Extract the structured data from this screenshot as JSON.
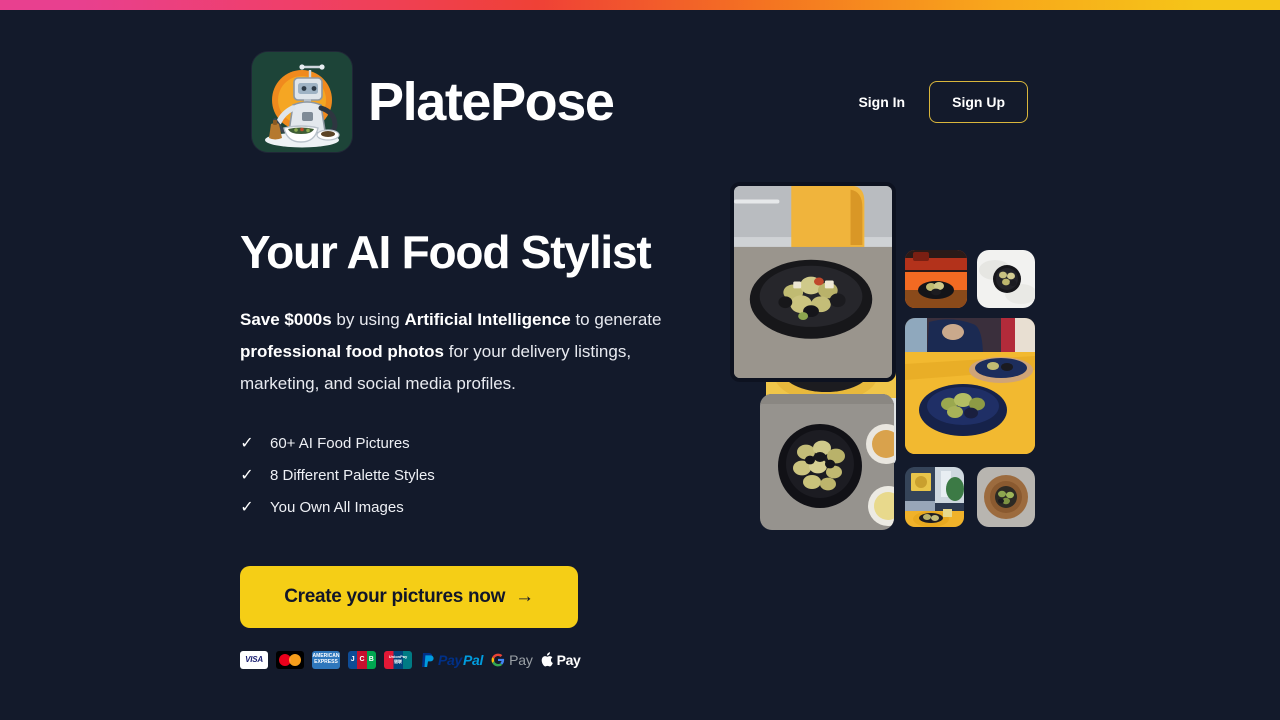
{
  "theme": {
    "background": "#131a2b",
    "accent_yellow": "#f5ce16",
    "border_gold": "#d9b63c",
    "gradient_start": "#e8408f",
    "gradient_mid": "#ef4136",
    "gradient_end": "#f5c518",
    "text_primary": "#ffffff",
    "text_body": "#e8eaf0"
  },
  "header": {
    "brand_name": "PlatePose",
    "logo_icon": "robot-chef-logo",
    "sign_in_label": "Sign In",
    "sign_up_label": "Sign Up"
  },
  "hero": {
    "title": "Your AI Food Stylist",
    "description": {
      "bold_1": "Save $000s",
      "text_1": " by using ",
      "bold_2": "Artificial Intelligence",
      "text_2": " to generate ",
      "bold_3": "professional food photos",
      "text_3": " for your delivery listings, marketing, and social media profiles."
    },
    "features": [
      {
        "check_icon": "check-icon",
        "label": "60+ AI Food Pictures"
      },
      {
        "check_icon": "check-icon",
        "label": "8 Different Palette Styles"
      },
      {
        "check_icon": "check-icon",
        "label": "You Own All Images"
      }
    ],
    "cta": {
      "label": "Create your pictures now",
      "arrow_icon": "arrow-right-icon",
      "arrow_glyph": "→"
    }
  },
  "payments": {
    "methods": [
      {
        "id": "visa",
        "label": "VISA",
        "icon": "visa-icon"
      },
      {
        "id": "mastercard",
        "label": "Mastercard",
        "icon": "mastercard-icon"
      },
      {
        "id": "amex",
        "label": "AMERICAN EXPRESS",
        "icon": "amex-icon"
      },
      {
        "id": "jcb",
        "label": "JCB",
        "icon": "jcb-icon"
      },
      {
        "id": "unionpay",
        "label": "UnionPay",
        "icon": "unionpay-icon"
      },
      {
        "id": "paypal",
        "label": "PayPal",
        "icon": "paypal-icon"
      },
      {
        "id": "gpay",
        "label": "Pay",
        "icon": "google-pay-icon"
      },
      {
        "id": "applepay",
        "label": "Pay",
        "icon": "apple-pay-icon"
      }
    ],
    "amex_line1": "AMERICAN",
    "amex_line2": "EXPRESS",
    "jcb_j": "J",
    "jcb_c": "C",
    "jcb_b": "B",
    "unionpay_line1": "UnionPay",
    "unionpay_line2": "银联",
    "paypal_pay": "Pay",
    "paypal_pal": "Pal",
    "gpay_g": "G",
    "gpay_pay": "Pay",
    "applepay_glyph": "",
    "applepay_pay": "Pay"
  },
  "collage": {
    "tiles": [
      {
        "id": "hero-bowl",
        "alt": "Dark bowl of olives and potatoes on counter with yellow kettle"
      },
      {
        "id": "under-bowl",
        "alt": "Bowl of olives on yellow plate"
      },
      {
        "id": "thumb-warm",
        "alt": "Bowl of olives in warm red lit kitchen"
      },
      {
        "id": "thumb-white",
        "alt": "Small dark bowl of olives on white marble"
      },
      {
        "id": "blue-bowl",
        "alt": "Blue bowl of olives on yellow cafe table"
      },
      {
        "id": "gray-topdown",
        "alt": "Top down dark bowl of olives on gray surface"
      },
      {
        "id": "thumb-interior",
        "alt": "Plate of food on yellow table in styled interior"
      },
      {
        "id": "thumb-wood",
        "alt": "Top down wooden bowl of olives"
      }
    ]
  }
}
